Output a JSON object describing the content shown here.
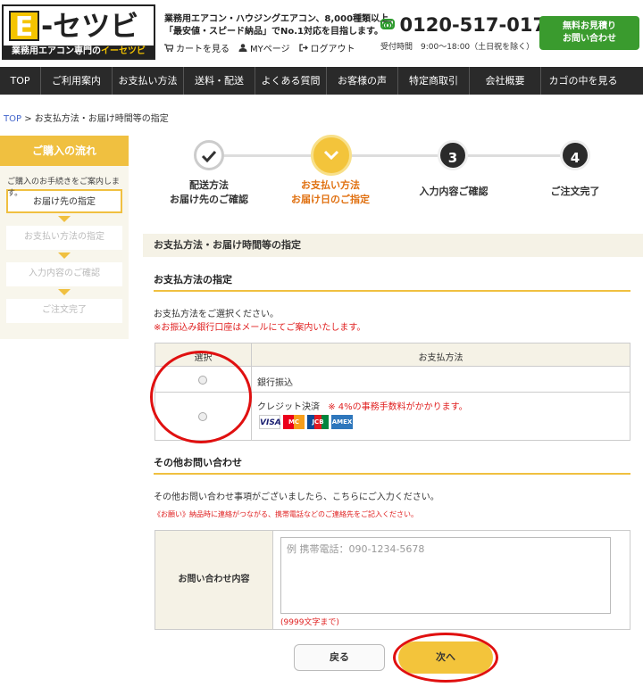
{
  "header": {
    "logo_letter": "E",
    "logo_main": "-セツビ",
    "logo_sub_prefix": "業務用エアコン専門の",
    "logo_sub_highlight": "イーセツビ",
    "tagline_1": "業務用エアコン・ハウジングエアコン、8,000種類以上。",
    "tagline_2": "「最安値・スピード納品」でNo.1対応を目指します。",
    "link_cart": "カートを見る",
    "link_mypage": "MYページ",
    "link_logout": "ログアウト",
    "phone": "0120-517-017",
    "hours": "受付時間　9:00～18:00（土日祝を除く）",
    "cta_1": "無料お見積り",
    "cta_2": "お問い合わせ"
  },
  "nav": [
    "TOP",
    "ご利用案内",
    "お支払い方法",
    "送料・配送",
    "よくある質問",
    "お客様の声",
    "特定商取引",
    "会社概要",
    "カゴの中を見る"
  ],
  "breadcrumb": {
    "home": "TOP",
    "sep": " > ",
    "current": "お支払方法・お届け時間等の指定"
  },
  "sidebar": {
    "title": "ご購入の流れ",
    "desc": "ご購入のお手続きをご案内します。",
    "steps": [
      "お届け先の指定",
      "お支払い方法の指定",
      "入力内容のご確認",
      "ご注文完了"
    ]
  },
  "progress": {
    "step1_l1": "配送方法",
    "step1_l2": "お届け先のご確認",
    "step2_l1": "お支払い方法",
    "step2_l2": "お届け日のご指定",
    "step3_num": "3",
    "step3_label": "入力内容ご確認",
    "step4_num": "4",
    "step4_label": "ご注文完了",
    "current_step": 2
  },
  "section_title": "お支払方法・お届け時間等の指定",
  "payment": {
    "heading": "お支払方法の指定",
    "instruction": "お支払方法をご選択ください。",
    "note": "※お振込み銀行口座はメールにてご案内いたします。",
    "col_select": "選択",
    "col_method": "お支払方法",
    "option1": "銀行振込",
    "option2": "クレジット決済",
    "option2_note": "※ 4%の事務手数料がかかります。",
    "cards": [
      "VISA",
      "MC",
      "JCB",
      "AMEX"
    ]
  },
  "inquiry": {
    "heading": "その他お問い合わせ",
    "instruction": "その他お問い合わせ事項がございましたら、こちらにご入力ください。",
    "note": "《お願い》納品時に連絡がつながる、携帯電話などのご連絡先をご記入ください。",
    "label": "お問い合わせ内容",
    "placeholder": "例 携帯電話：090-1234-5678",
    "limit": "(9999文字まで)"
  },
  "buttons": {
    "back": "戻る",
    "next": "次へ"
  },
  "colors": {
    "accent": "#f0c040",
    "nav_bg": "#2a2a2a",
    "cta_green": "#3a9b2e",
    "highlight_red": "#e01010"
  }
}
